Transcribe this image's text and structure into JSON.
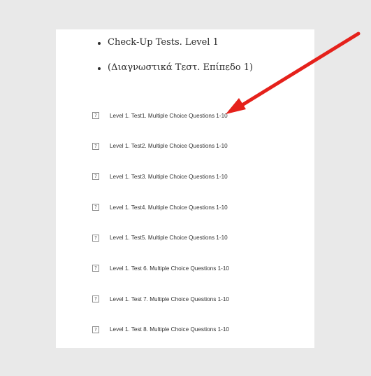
{
  "headings": [
    {
      "text": "Check-Up Tests. Level 1"
    },
    {
      "text": "(Διαγνωστικά Τεστ. Επίπεδο 1)"
    }
  ],
  "tests": [
    {
      "label": "Level 1. Test1. Multiple Choice Questions 1-10"
    },
    {
      "label": "Level 1. Test2. Multiple Choice Questions 1-10"
    },
    {
      "label": "Level 1. Test3. Multiple Choice Questions 1-10"
    },
    {
      "label": "Level 1. Test4. Multiple Choice Questions 1-10"
    },
    {
      "label": "Level 1. Test5. Multiple Choice Questions 1-10"
    },
    {
      "label": "Level 1. Test 6. Multiple Choice Questions 1-10"
    },
    {
      "label": "Level 1. Test 7. Multiple Choice Questions 1-10"
    },
    {
      "label": "Level 1. Test 8. Multiple Choice Questions 1-10"
    }
  ],
  "icons": {
    "test_icon": "question-mark-icon",
    "annotation": "red-arrow-icon"
  },
  "colors": {
    "background": "#e9e9e9",
    "page": "#ffffff",
    "arrow": "#e5211b"
  }
}
